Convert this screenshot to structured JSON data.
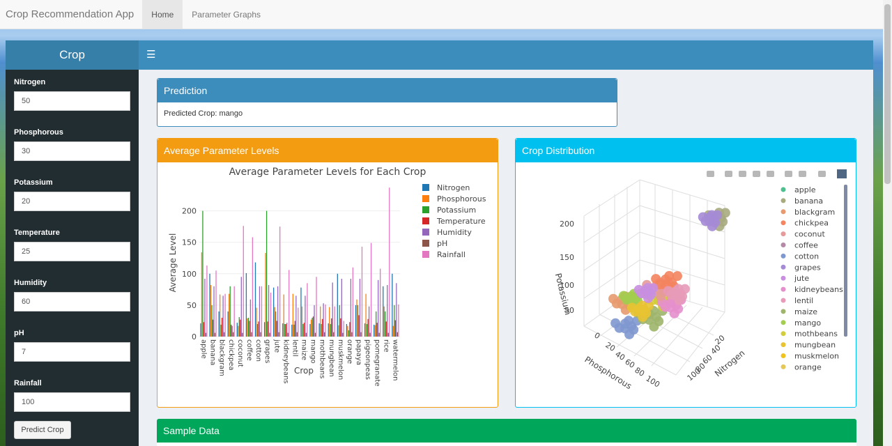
{
  "navbar": {
    "brand": "Crop Recommendation App",
    "tabs": [
      {
        "label": "Home",
        "active": true
      },
      {
        "label": "Parameter Graphs",
        "active": false
      }
    ]
  },
  "sidebar": {
    "title": "Crop",
    "fields": [
      {
        "label": "Nitrogen",
        "value": "50"
      },
      {
        "label": "Phosphorous",
        "value": "30"
      },
      {
        "label": "Potassium",
        "value": "20"
      },
      {
        "label": "Temperature",
        "value": "25"
      },
      {
        "label": "Humidity",
        "value": "60"
      },
      {
        "label": "pH",
        "value": "7"
      },
      {
        "label": "Rainfall",
        "value": "100"
      }
    ],
    "predict_button": "Predict Crop"
  },
  "prediction": {
    "title": "Prediction",
    "text": "Predicted Crop: mango"
  },
  "avg_box": {
    "title": "Average Parameter Levels"
  },
  "dist_box": {
    "title": "Crop Distribution"
  },
  "sample_box": {
    "title": "Sample Data"
  },
  "colors": {
    "header_blue": "#3c8dbc",
    "orange": "#f39c12",
    "aqua": "#00c0ef",
    "green": "#00a65a",
    "sidebar": "#222d32"
  },
  "chart_data": [
    {
      "type": "bar",
      "title": "Average Parameter Levels for Each Crop",
      "xlabel": "Crop",
      "ylabel": "Average Level",
      "ylim": [
        0,
        235
      ],
      "yticks": [
        0,
        50,
        100,
        150,
        200
      ],
      "grid": true,
      "legend_position": "top-right",
      "categories": [
        "apple",
        "banana",
        "blackgram",
        "chickpea",
        "coconut",
        "coffee",
        "cotton",
        "grapes",
        "jute",
        "kidneybeans",
        "lentil",
        "maize",
        "mango",
        "mothbeans",
        "mungbean",
        "muskmelon",
        "orange",
        "papaya",
        "pigeonpeas",
        "pomegranate",
        "rice",
        "watermelon"
      ],
      "series": [
        {
          "name": "Nitrogen",
          "color": "#1f77b4",
          "values": [
            21,
            100,
            40,
            40,
            22,
            101,
            118,
            23,
            78,
            21,
            19,
            78,
            20,
            21,
            21,
            100,
            20,
            50,
            21,
            19,
            80,
            100
          ]
        },
        {
          "name": "Phosphorous",
          "color": "#ff7f0e",
          "values": [
            134,
            82,
            67,
            68,
            17,
            29,
            46,
            133,
            47,
            67,
            68,
            48,
            27,
            48,
            47,
            18,
            17,
            59,
            68,
            18,
            48,
            17
          ]
        },
        {
          "name": "Potassium",
          "color": "#2ca02c",
          "values": [
            200,
            50,
            19,
            80,
            31,
            30,
            20,
            200,
            40,
            20,
            19,
            20,
            30,
            20,
            20,
            50,
            10,
            50,
            20,
            40,
            40,
            50
          ]
        },
        {
          "name": "Temperature",
          "color": "#d62728",
          "values": [
            23,
            27,
            30,
            19,
            27,
            25,
            24,
            24,
            25,
            20,
            25,
            22,
            32,
            28,
            29,
            29,
            23,
            34,
            28,
            22,
            24,
            26
          ]
        },
        {
          "name": "Humidity",
          "color": "#9467bd",
          "values": [
            92,
            80,
            65,
            17,
            95,
            59,
            80,
            82,
            80,
            22,
            65,
            65,
            50,
            53,
            86,
            92,
            92,
            92,
            48,
            90,
            82,
            85
          ]
        },
        {
          "name": "pH",
          "color": "#8c564b",
          "values": [
            6,
            6,
            7,
            7,
            6,
            7,
            7,
            6,
            7,
            6,
            7,
            6,
            6,
            7,
            7,
            6,
            7,
            7,
            6,
            6,
            6,
            7
          ]
        },
        {
          "name": "Rainfall",
          "color": "#e377c2",
          "values": [
            113,
            105,
            68,
            80,
            176,
            158,
            80,
            70,
            175,
            106,
            46,
            85,
            95,
            51,
            48,
            25,
            110,
            143,
            149,
            108,
            237,
            51
          ]
        }
      ]
    },
    {
      "type": "scatter",
      "subtype": "scatter3d",
      "axes": {
        "z_label": "Potassium",
        "x_label": "Phosphorous",
        "y_label": "Nitrogen"
      },
      "z_ticks": [
        "50",
        "100",
        "150",
        "200"
      ],
      "x_ticks": [
        "0",
        "20",
        "40",
        "60",
        "80",
        "100"
      ],
      "y_ticks": [
        "20",
        "40",
        "60",
        "80",
        "100"
      ],
      "legend_position": "right",
      "legend": [
        {
          "name": "apple",
          "color": "#4fbf8f"
        },
        {
          "name": "banana",
          "color": "#a9ab7f"
        },
        {
          "name": "blackgram",
          "color": "#e89a6e"
        },
        {
          "name": "chickpea",
          "color": "#f4845f"
        },
        {
          "name": "coconut",
          "color": "#e69a9a"
        },
        {
          "name": "coffee",
          "color": "#b58aa6"
        },
        {
          "name": "cotton",
          "color": "#7f98cf"
        },
        {
          "name": "grapes",
          "color": "#a58ad6"
        },
        {
          "name": "jute",
          "color": "#c88fe0"
        },
        {
          "name": "kidneybeans",
          "color": "#e58fcd"
        },
        {
          "name": "lentil",
          "color": "#e79bb8"
        },
        {
          "name": "maize",
          "color": "#9fb56b"
        },
        {
          "name": "mango",
          "color": "#a2cd4f"
        },
        {
          "name": "mothbeans",
          "color": "#d3cc3b"
        },
        {
          "name": "mungbean",
          "color": "#e8c332"
        },
        {
          "name": "muskmelon",
          "color": "#f0c21f"
        },
        {
          "name": "orange",
          "color": "#e6c75a"
        }
      ]
    }
  ]
}
